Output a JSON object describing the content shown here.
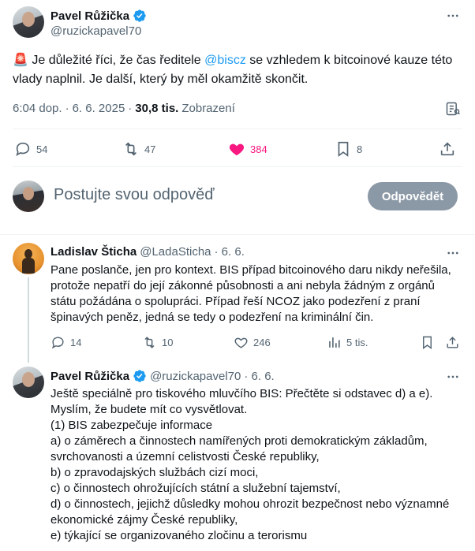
{
  "main_tweet": {
    "author_name": "Pavel Růžička",
    "author_handle": "@ruzickapavel70",
    "alert_emoji": "🚨",
    "text_before_mention": " Je důležité říci, že čas ředitele ",
    "mention": "@biscz",
    "text_after_mention": " se vzhledem k bitcoinové kauze této vlady naplnil. Je další, který by měl okamžitě skončit.",
    "time": "6:04 dop.",
    "dot": "·",
    "date": "6. 6. 2025",
    "views_count": "30,8 tis.",
    "views_label": "Zobrazení",
    "stats": {
      "replies": "54",
      "reposts": "47",
      "likes": "384",
      "bookmarks": "8"
    }
  },
  "reply_composer": {
    "placeholder": "Postujte svou odpověď",
    "button_label": "Odpovědět"
  },
  "replies": [
    {
      "author_name": "Ladislav Šticha",
      "author_handle": "@LadaSticha",
      "date": "· 6. 6.",
      "text": "Pane poslanče, jen pro kontext. BIS případ bitcoinového daru nikdy neřešila, protože nepatří do její zákonné působnosti a ani nebyla žádným z orgánů státu požádána o spolupráci. Případ řeší NCOZ jako podezření z praní špinavých peněz, jedná se tedy o podezření na kriminální čin.",
      "stats": {
        "replies": "14",
        "reposts": "10",
        "likes": "246",
        "views": "5 tis."
      }
    },
    {
      "author_name": "Pavel Růžička",
      "author_handle": "@ruzickapavel70",
      "date": "· 6. 6.",
      "text": "Ještě speciálně pro tiskového mluvčího BIS:  Přečtěte si odstavec d) a e).\nMyslím, že budete mít co vysvětlovat.\n(1) BIS zabezpečuje informace\na) o záměrech a činnostech namířených proti demokratickým základům, svrchovanosti a územní celistvosti České republiky,\nb) o zpravodajských službách cizí moci,\nc) o činnostech ohrožujících státní a služební tajemství,\nd) o činnostech, jejichž důsledky mohou ohrozit bezpečnost nebo významné ekonomické zájmy České republiky,\ne) týkající se organizovaného zločinu a terorismu"
    }
  ],
  "colors": {
    "accent": "#1d9bf0",
    "like_active": "#f91880",
    "muted": "#536471",
    "verified": "#1d9bf0"
  },
  "icons": [
    "more-icon",
    "verified-badge-icon",
    "siren-emoji",
    "analytics-icon",
    "reply-icon",
    "repost-icon",
    "like-icon",
    "bookmark-icon",
    "share-icon",
    "views-icon"
  ]
}
